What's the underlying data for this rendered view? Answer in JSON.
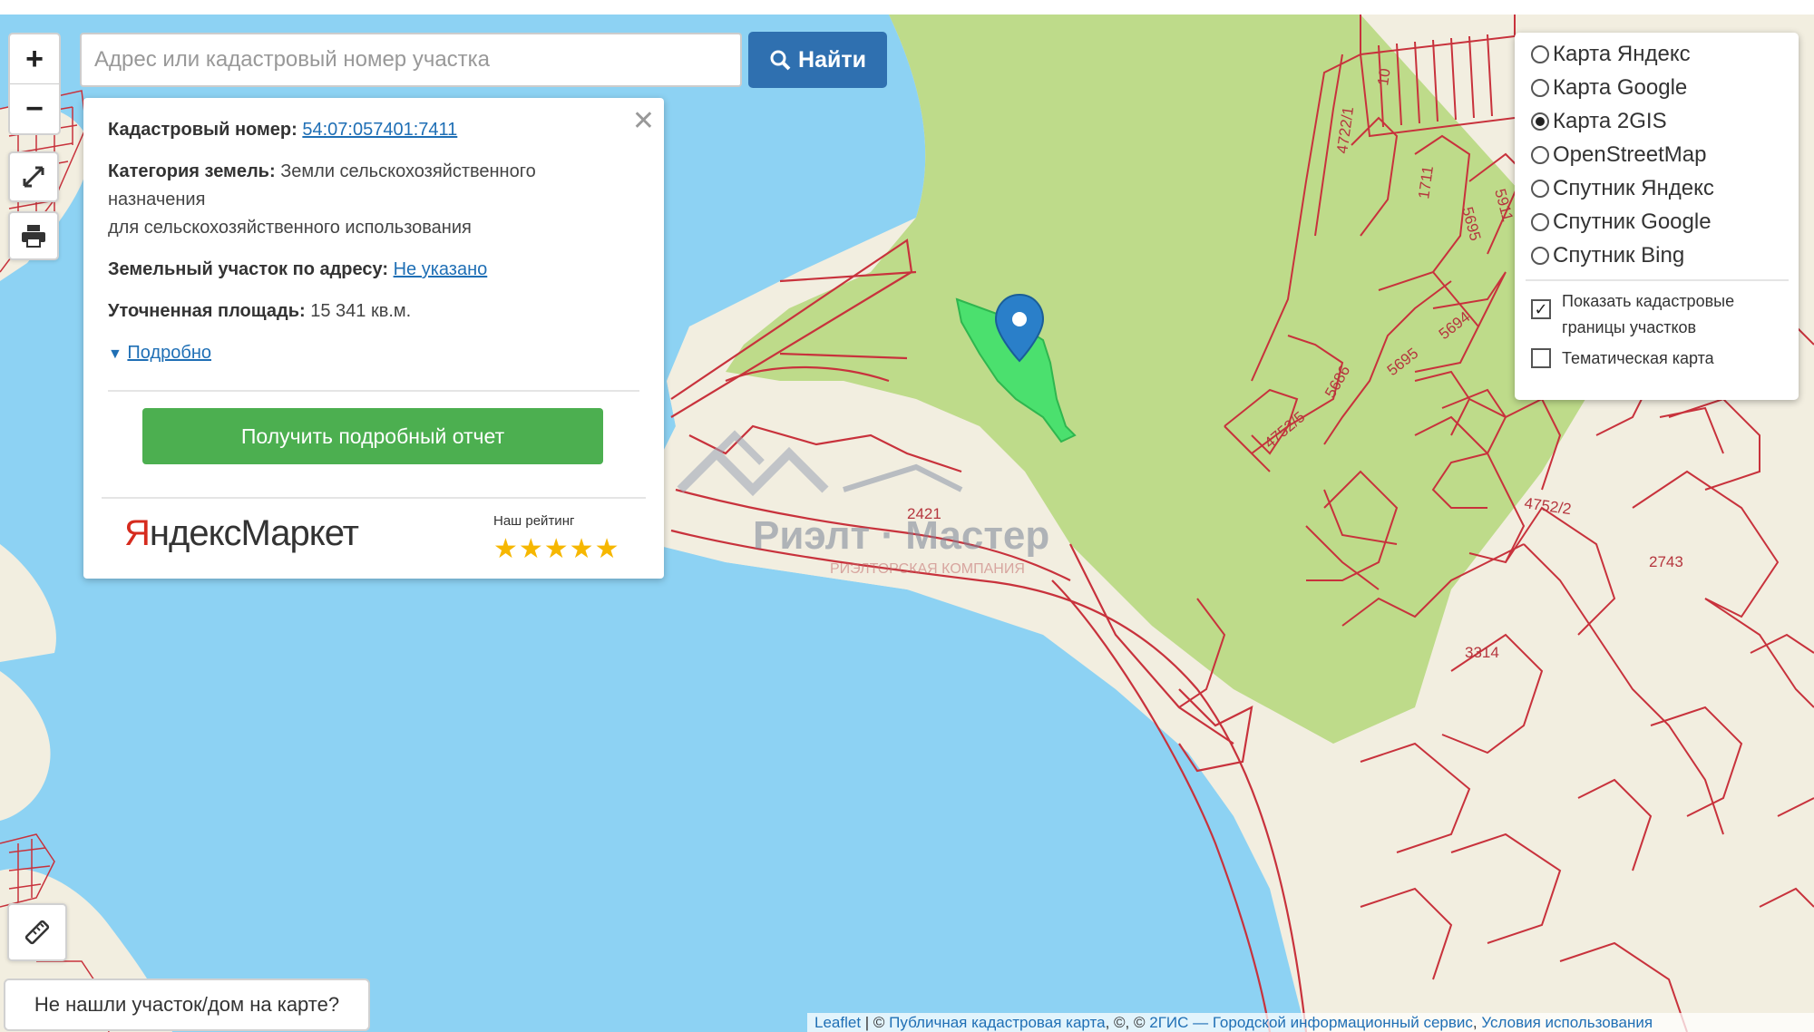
{
  "search": {
    "placeholder": "Адрес или кадастровый номер участка",
    "button_label": "Найти"
  },
  "controls": {
    "zoom_in": "+",
    "zoom_out": "−"
  },
  "popup": {
    "cadastral_label": "Кадастровый номер:",
    "cadastral_value": "54:07:057401:7411",
    "category_label": "Категория земель:",
    "category_value_line1": "Земли сельскохозяйственного",
    "category_value_line2": "назначения",
    "usage": "для сельскохозяйственного использования",
    "address_label": "Земельный участок по адресу:",
    "address_value": "Не указано",
    "area_label": "Уточненная площадь:",
    "area_value": "15 341 кв.м.",
    "details_link": "Подробно",
    "report_button": "Получить подробный отчет",
    "market_logo_a": "Я",
    "market_logo_b": "ндекс",
    "market_logo_c": "Маркет",
    "rating_label": "Наш рейтинг",
    "stars": "★★★★★"
  },
  "layers": {
    "options": [
      {
        "label": "Карта Яндекс",
        "selected": false
      },
      {
        "label": "Карта Google",
        "selected": false
      },
      {
        "label": "Карта 2GIS",
        "selected": true
      },
      {
        "label": "OpenStreetMap",
        "selected": false
      },
      {
        "label": "Спутник Яндекс",
        "selected": false
      },
      {
        "label": "Спутник Google",
        "selected": false
      },
      {
        "label": "Спутник Bing",
        "selected": false
      }
    ],
    "show_borders_line1": "Показать кадастровые",
    "show_borders_line2": "границы участков",
    "show_borders_checked": true,
    "thematic_map": "Тематическая карта",
    "thematic_checked": false
  },
  "map_labels": {
    "l_4722_1": "4722/1",
    "l_10": "10",
    "l_1711": "1711",
    "l_5695a": "5695",
    "l_5911": "5911",
    "l_5694": "5694",
    "l_5695b": "5695",
    "l_5686": "5686",
    "l_4752_5": "4752/5",
    "l_4752_2": "4752/2",
    "l_2421": "2421",
    "l_2743": "2743",
    "l_3314": "3314"
  },
  "watermark": {
    "main": "Риэлт · Мастер",
    "sub": "РИЭЛТОРСКАЯ КОМПАНИЯ"
  },
  "footer": {
    "not_found": "Не нашли участок/дом на карте?",
    "attr_leaflet": "Leaflet",
    "attr_sep1": " | © ",
    "attr_pkk": "Публичная кадастровая карта",
    "attr_sep2": ", ©, © ",
    "attr_2gis": "2ГИС — Городской информационный сервис",
    "attr_sep3": ", ",
    "attr_terms": "Условия использования"
  },
  "colors": {
    "water": "#8dd2f3",
    "forest": "#bedb8a",
    "land": "#f2eee0",
    "parcel_border": "#c8323c",
    "selected_parcel": "#3ee06a",
    "marker": "#2a7fc9"
  }
}
